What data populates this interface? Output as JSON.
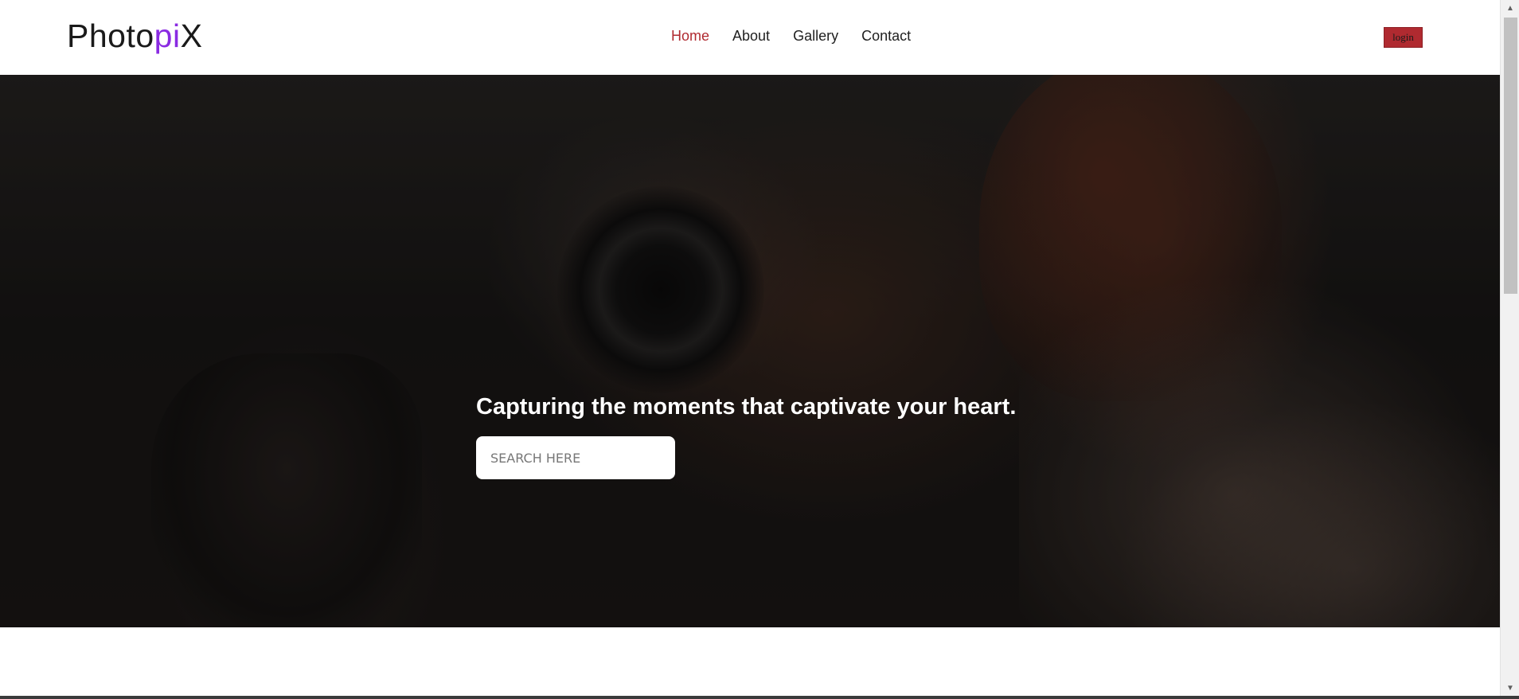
{
  "header": {
    "logo_prefix": "Photo",
    "logo_accent": "pi",
    "logo_suffix": "X",
    "nav": [
      {
        "label": "Home",
        "active": true
      },
      {
        "label": "About",
        "active": false
      },
      {
        "label": "Gallery",
        "active": false
      },
      {
        "label": "Contact",
        "active": false
      }
    ],
    "login_label": "login"
  },
  "hero": {
    "headline": "Capturing the moments that captivate your heart.",
    "search_placeholder": "SEARCH HERE",
    "search_value": ""
  },
  "colors": {
    "accent": "#b02a30",
    "logo_accent": "#8a2be2"
  },
  "icons": {
    "scroll_up": "chevron-up-icon",
    "scroll_down": "chevron-down-icon"
  }
}
